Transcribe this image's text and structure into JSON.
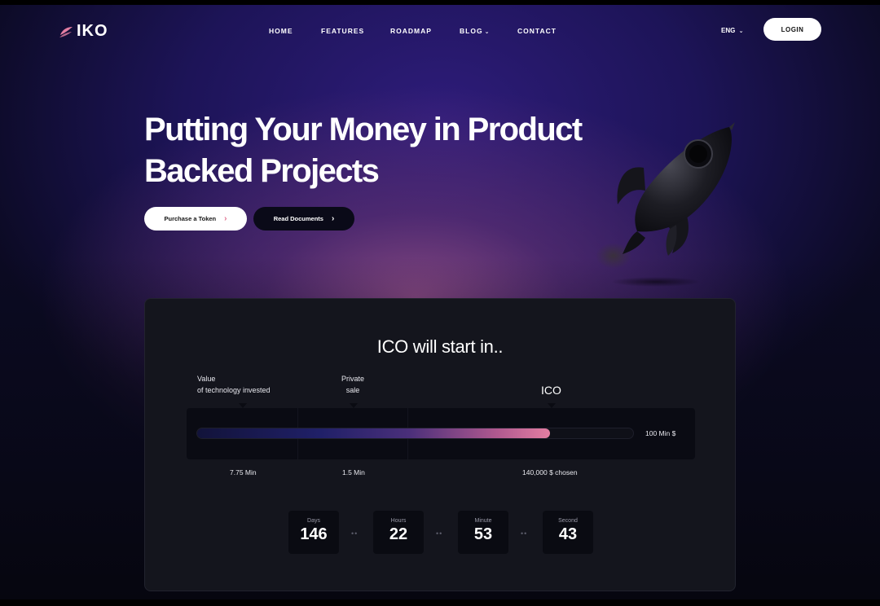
{
  "brand": {
    "name": "IKO",
    "accent": "#e37ea2"
  },
  "nav": {
    "items": [
      {
        "label": "HOME"
      },
      {
        "label": "FEATURES"
      },
      {
        "label": "ROADMAP"
      },
      {
        "label": "BLOG",
        "has_dropdown": true
      },
      {
        "label": "CONTACT"
      }
    ],
    "language": "ENG",
    "login_label": "LOGIN"
  },
  "hero": {
    "title_line1": "Putting Your Money in Product",
    "title_line2": "Backed Projects",
    "primary_button": "Purchase a Token",
    "secondary_button": "Read Documents"
  },
  "ico": {
    "title": "ICO will start in..",
    "stage_labels": {
      "value_line1": "Value",
      "value_line2": "of technology invested",
      "private_line1": "Private",
      "private_line2": "sale",
      "ico": "ICO"
    },
    "progress_fraction": 0.81,
    "bar_end_label": "100 Min $",
    "under_labels": {
      "first": "7.75 Min",
      "second": "1.5 Min",
      "third": "140,000 $ chosen"
    },
    "countdown": [
      {
        "unit": "Days",
        "value": "146"
      },
      {
        "unit": "Hours",
        "value": "22"
      },
      {
        "unit": "Minute",
        "value": "53"
      },
      {
        "unit": "Second",
        "value": "43"
      }
    ]
  }
}
